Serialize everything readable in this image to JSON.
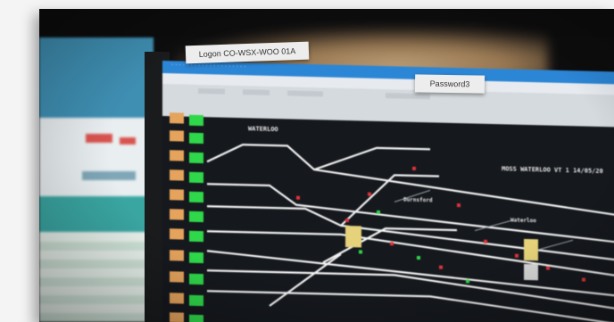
{
  "tabs": {
    "logon": "Logon CO-WSX-WOO 01A",
    "password": "Password3"
  },
  "screen": {
    "header_station": "WATERLOO",
    "header_id": "MOSS WATERLOO VT 1 14/05/20",
    "label_1": "Waterloo",
    "label_2": "Durnsford",
    "colors": {
      "signal_green": "#2fd84a",
      "signal_orange": "#e5a35c",
      "track_white": "#f2f2f2",
      "signal_red": "#e0333a",
      "route_yellow": "#e6d27a",
      "titlebar_blue": "#2c86d6"
    }
  }
}
